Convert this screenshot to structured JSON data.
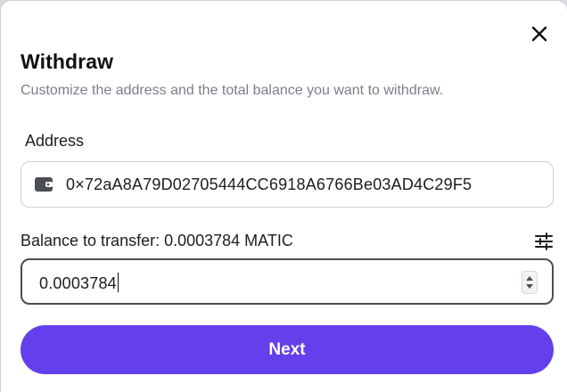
{
  "modal": {
    "title": "Withdraw",
    "subtitle": "Customize the address and the total balance you want to withdraw.",
    "close_icon": "close-icon"
  },
  "address": {
    "label": "Address",
    "value": "0×72aA8A79D02705444CC6918A6766Be03AD4C29F5",
    "icon": "wallet-icon"
  },
  "balance": {
    "label": "Balance to transfer: 0.0003784 MATIC",
    "settings_icon": "sliders-icon",
    "amount_value": "0.0003784"
  },
  "actions": {
    "next_label": "Next"
  },
  "colors": {
    "accent": "#6340ec",
    "subtitle": "#7b7f89",
    "text": "#1d1d1f"
  }
}
